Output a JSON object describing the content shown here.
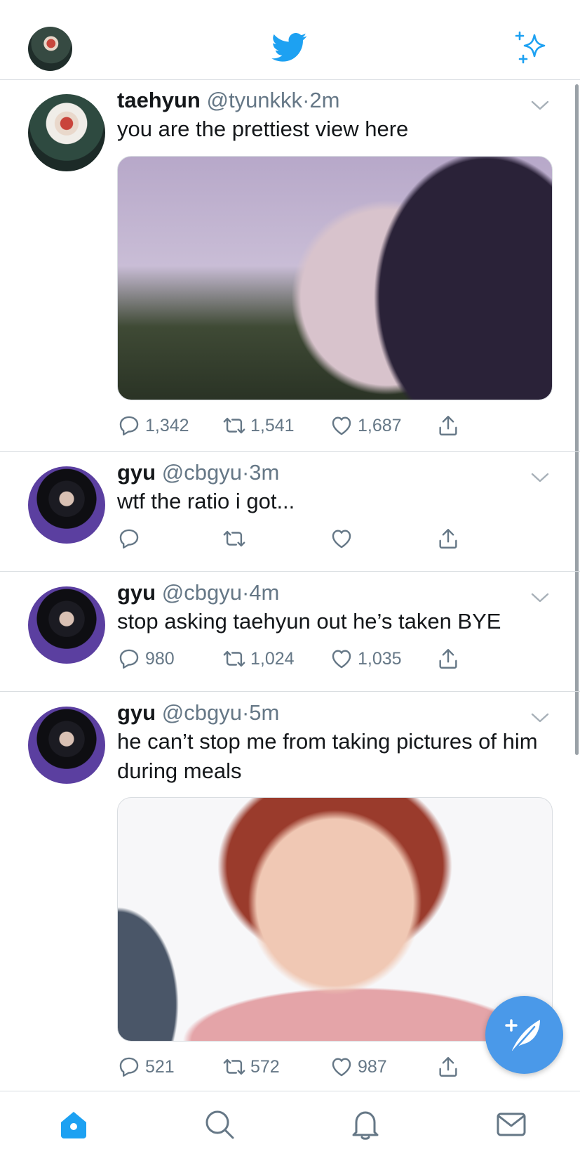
{
  "app": {
    "accent_color": "#1da1f2",
    "muted_color": "#657786"
  },
  "header": {
    "avatar_icon": "user-avatar",
    "logo_icon": "twitter-bird-icon",
    "sparkle_icon": "sparkle-icon"
  },
  "tweets": [
    {
      "name": "taehyun",
      "handle": "@tyunkkk",
      "dot": "·",
      "time": "2m",
      "text": "you are the prettiest view here",
      "has_media": true,
      "replies": "1,342",
      "retweets": "1,541",
      "likes": "1,687"
    },
    {
      "name": "gyu",
      "handle": "@cbgyu",
      "dot": "·",
      "time": "3m",
      "text": "wtf the ratio i got...",
      "has_media": false,
      "replies": "",
      "retweets": "",
      "likes": ""
    },
    {
      "name": "gyu",
      "handle": "@cbgyu",
      "dot": "·",
      "time": "4m",
      "text": "stop asking taehyun out he’s taken BYE",
      "has_media": false,
      "replies": "980",
      "retweets": "1,024",
      "likes": "1,035"
    },
    {
      "name": "gyu",
      "handle": "@cbgyu",
      "dot": "·",
      "time": "5m",
      "text": "he can’t stop me from taking pictures of him during meals",
      "has_media": true,
      "replies": "521",
      "retweets": "572",
      "likes": "987"
    }
  ],
  "fab": {
    "icon": "compose-tweet-icon"
  },
  "bottom_nav": [
    "home-icon",
    "search-icon",
    "notifications-icon",
    "messages-icon"
  ]
}
